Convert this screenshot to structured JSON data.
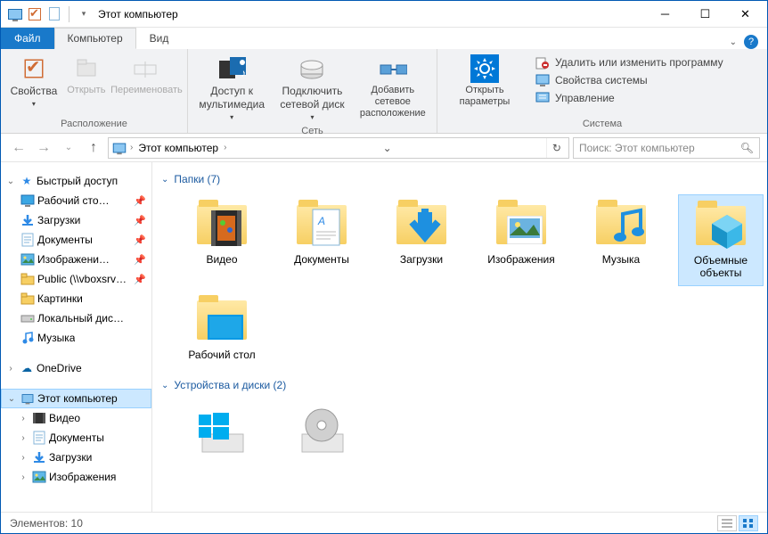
{
  "window": {
    "title": "Этот компьютер"
  },
  "tabs": {
    "file": "Файл",
    "computer": "Компьютер",
    "view": "Вид"
  },
  "ribbon": {
    "groups": {
      "location": {
        "label": "Расположение",
        "properties": "Свойства",
        "open": "Открыть",
        "rename": "Переименовать"
      },
      "network": {
        "label": "Сеть",
        "media": "Доступ к мультимедиа",
        "mapdrive": "Подключить сетевой диск",
        "addloc": "Добавить сетевое расположение"
      },
      "system": {
        "label": "Система",
        "settings": "Открыть параметры",
        "uninstall": "Удалить или изменить программу",
        "sysprops": "Свойства системы",
        "manage": "Управление"
      }
    }
  },
  "nav": {
    "path": "Этот компьютер",
    "search_placeholder": "Поиск: Этот компьютер"
  },
  "tree": {
    "quick": {
      "label": "Быстрый доступ",
      "items": [
        {
          "label": "Рабочий сто…",
          "pin": true,
          "icon": "desktop"
        },
        {
          "label": "Загрузки",
          "pin": true,
          "icon": "downloads"
        },
        {
          "label": "Документы",
          "pin": true,
          "icon": "documents"
        },
        {
          "label": "Изображени…",
          "pin": true,
          "icon": "pictures"
        },
        {
          "label": "Public (\\\\vboxsrv…",
          "pin": true,
          "icon": "netfolder"
        },
        {
          "label": "Картинки",
          "pin": false,
          "icon": "folder"
        },
        {
          "label": "Локальный дис…",
          "pin": false,
          "icon": "drive"
        },
        {
          "label": "Музыка",
          "pin": false,
          "icon": "music"
        }
      ]
    },
    "onedrive": "OneDrive",
    "thispc": {
      "label": "Этот компьютер",
      "items": [
        {
          "label": "Видео",
          "icon": "video"
        },
        {
          "label": "Документы",
          "icon": "documents"
        },
        {
          "label": "Загрузки",
          "icon": "downloads"
        },
        {
          "label": "Изображения",
          "icon": "pictures"
        }
      ]
    }
  },
  "content": {
    "folders_header": "Папки (7)",
    "folders": [
      {
        "label": "Видео",
        "icon": "video"
      },
      {
        "label": "Документы",
        "icon": "documents"
      },
      {
        "label": "Загрузки",
        "icon": "downloads"
      },
      {
        "label": "Изображения",
        "icon": "pictures"
      },
      {
        "label": "Музыка",
        "icon": "music"
      },
      {
        "label": "Объемные объекты",
        "icon": "3d",
        "selected": true
      },
      {
        "label": "Рабочий стол",
        "icon": "desktop"
      }
    ],
    "drives_header": "Устройства и диски (2)"
  },
  "status": {
    "items": "Элементов: 10"
  }
}
